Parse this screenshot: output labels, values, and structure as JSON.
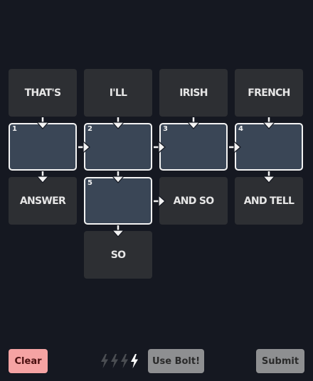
{
  "clues": [
    {
      "id": "thats",
      "text": "THAT'S"
    },
    {
      "id": "ill",
      "text": "I'LL"
    },
    {
      "id": "irish",
      "text": "IRISH"
    },
    {
      "id": "french",
      "text": "FRENCH"
    },
    {
      "id": "answer",
      "text": "ANSWER"
    },
    {
      "id": "and-so",
      "text": "AND SO"
    },
    {
      "id": "and-tell",
      "text": "AND TELL"
    },
    {
      "id": "so",
      "text": "SO"
    }
  ],
  "slots": [
    {
      "number": "1",
      "value": ""
    },
    {
      "number": "2",
      "value": ""
    },
    {
      "number": "3",
      "value": ""
    },
    {
      "number": "4",
      "value": ""
    },
    {
      "number": "5",
      "value": ""
    }
  ],
  "controls": {
    "clear_label": "Clear",
    "use_bolt_label": "Use Bolt!",
    "submit_label": "Submit"
  },
  "bolts": {
    "used": 3,
    "available": 1,
    "icon": "lightning-bolt-icon"
  },
  "colors": {
    "background": "#151821",
    "clue_tile": "#2d2f33",
    "slot_fill": "#3a4656",
    "slot_border": "#f2f2f2",
    "clear_button": "#f5a3a3",
    "disabled_button": "#8e8f91",
    "bolt_used": "#4a4d52",
    "bolt_available": "#ffffff"
  }
}
